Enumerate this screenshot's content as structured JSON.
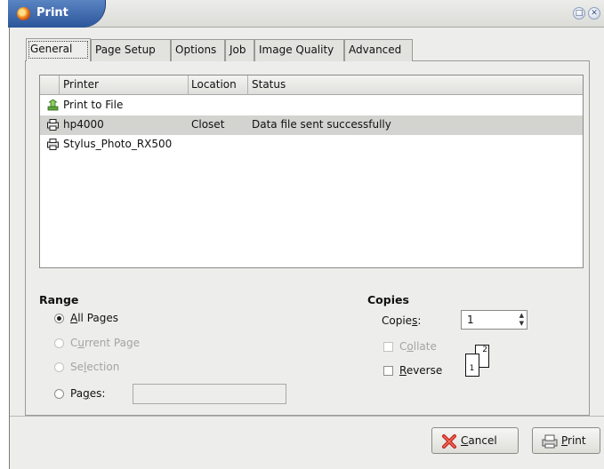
{
  "window": {
    "title": "Print"
  },
  "tabs": [
    {
      "label": "General"
    },
    {
      "label": "Page Setup"
    },
    {
      "label": "Options"
    },
    {
      "label": "Job"
    },
    {
      "label": "Image Quality"
    },
    {
      "label": "Advanced"
    }
  ],
  "printers": {
    "columns": [
      "Printer",
      "Location",
      "Status"
    ],
    "rows": [
      {
        "name": "Print to File",
        "location": "",
        "status": "",
        "icon": "print-to-file-icon"
      },
      {
        "name": "hp4000",
        "location": "Closet",
        "status": "Data file sent successfully",
        "icon": "printer-icon",
        "selected": true
      },
      {
        "name": "Stylus_Photo_RX500",
        "location": "",
        "status": "",
        "icon": "printer-icon"
      }
    ]
  },
  "range": {
    "title": "Range",
    "options": [
      {
        "pre": "",
        "key": "A",
        "post": "ll Pages",
        "checked": true,
        "enabled": true
      },
      {
        "pre": "C",
        "key": "u",
        "post": "rrent Page",
        "checked": false,
        "enabled": false
      },
      {
        "pre": "Se",
        "key": "l",
        "post": "ection",
        "checked": false,
        "enabled": false
      },
      {
        "pre": "Pa",
        "key": "g",
        "post": "es:",
        "checked": false,
        "enabled": true
      }
    ],
    "pages_value": ""
  },
  "copies": {
    "title": "Copies",
    "label_pre": "Copie",
    "label_key": "s",
    "label_post": ":",
    "value": "1",
    "collate": {
      "pre": "C",
      "key": "o",
      "post": "llate",
      "checked": false,
      "enabled": false
    },
    "reverse": {
      "pre": "",
      "key": "R",
      "post": "everse",
      "checked": false,
      "enabled": true
    },
    "collate_icon_sheets": [
      "1",
      "2"
    ]
  },
  "buttons": {
    "cancel": {
      "pre": "",
      "key": "C",
      "post": "ancel"
    },
    "print": {
      "pre": "",
      "key": "P",
      "post": "rint"
    }
  },
  "colors": {
    "title_accent": "#3d68ab",
    "selection": "#d3d3d0"
  }
}
